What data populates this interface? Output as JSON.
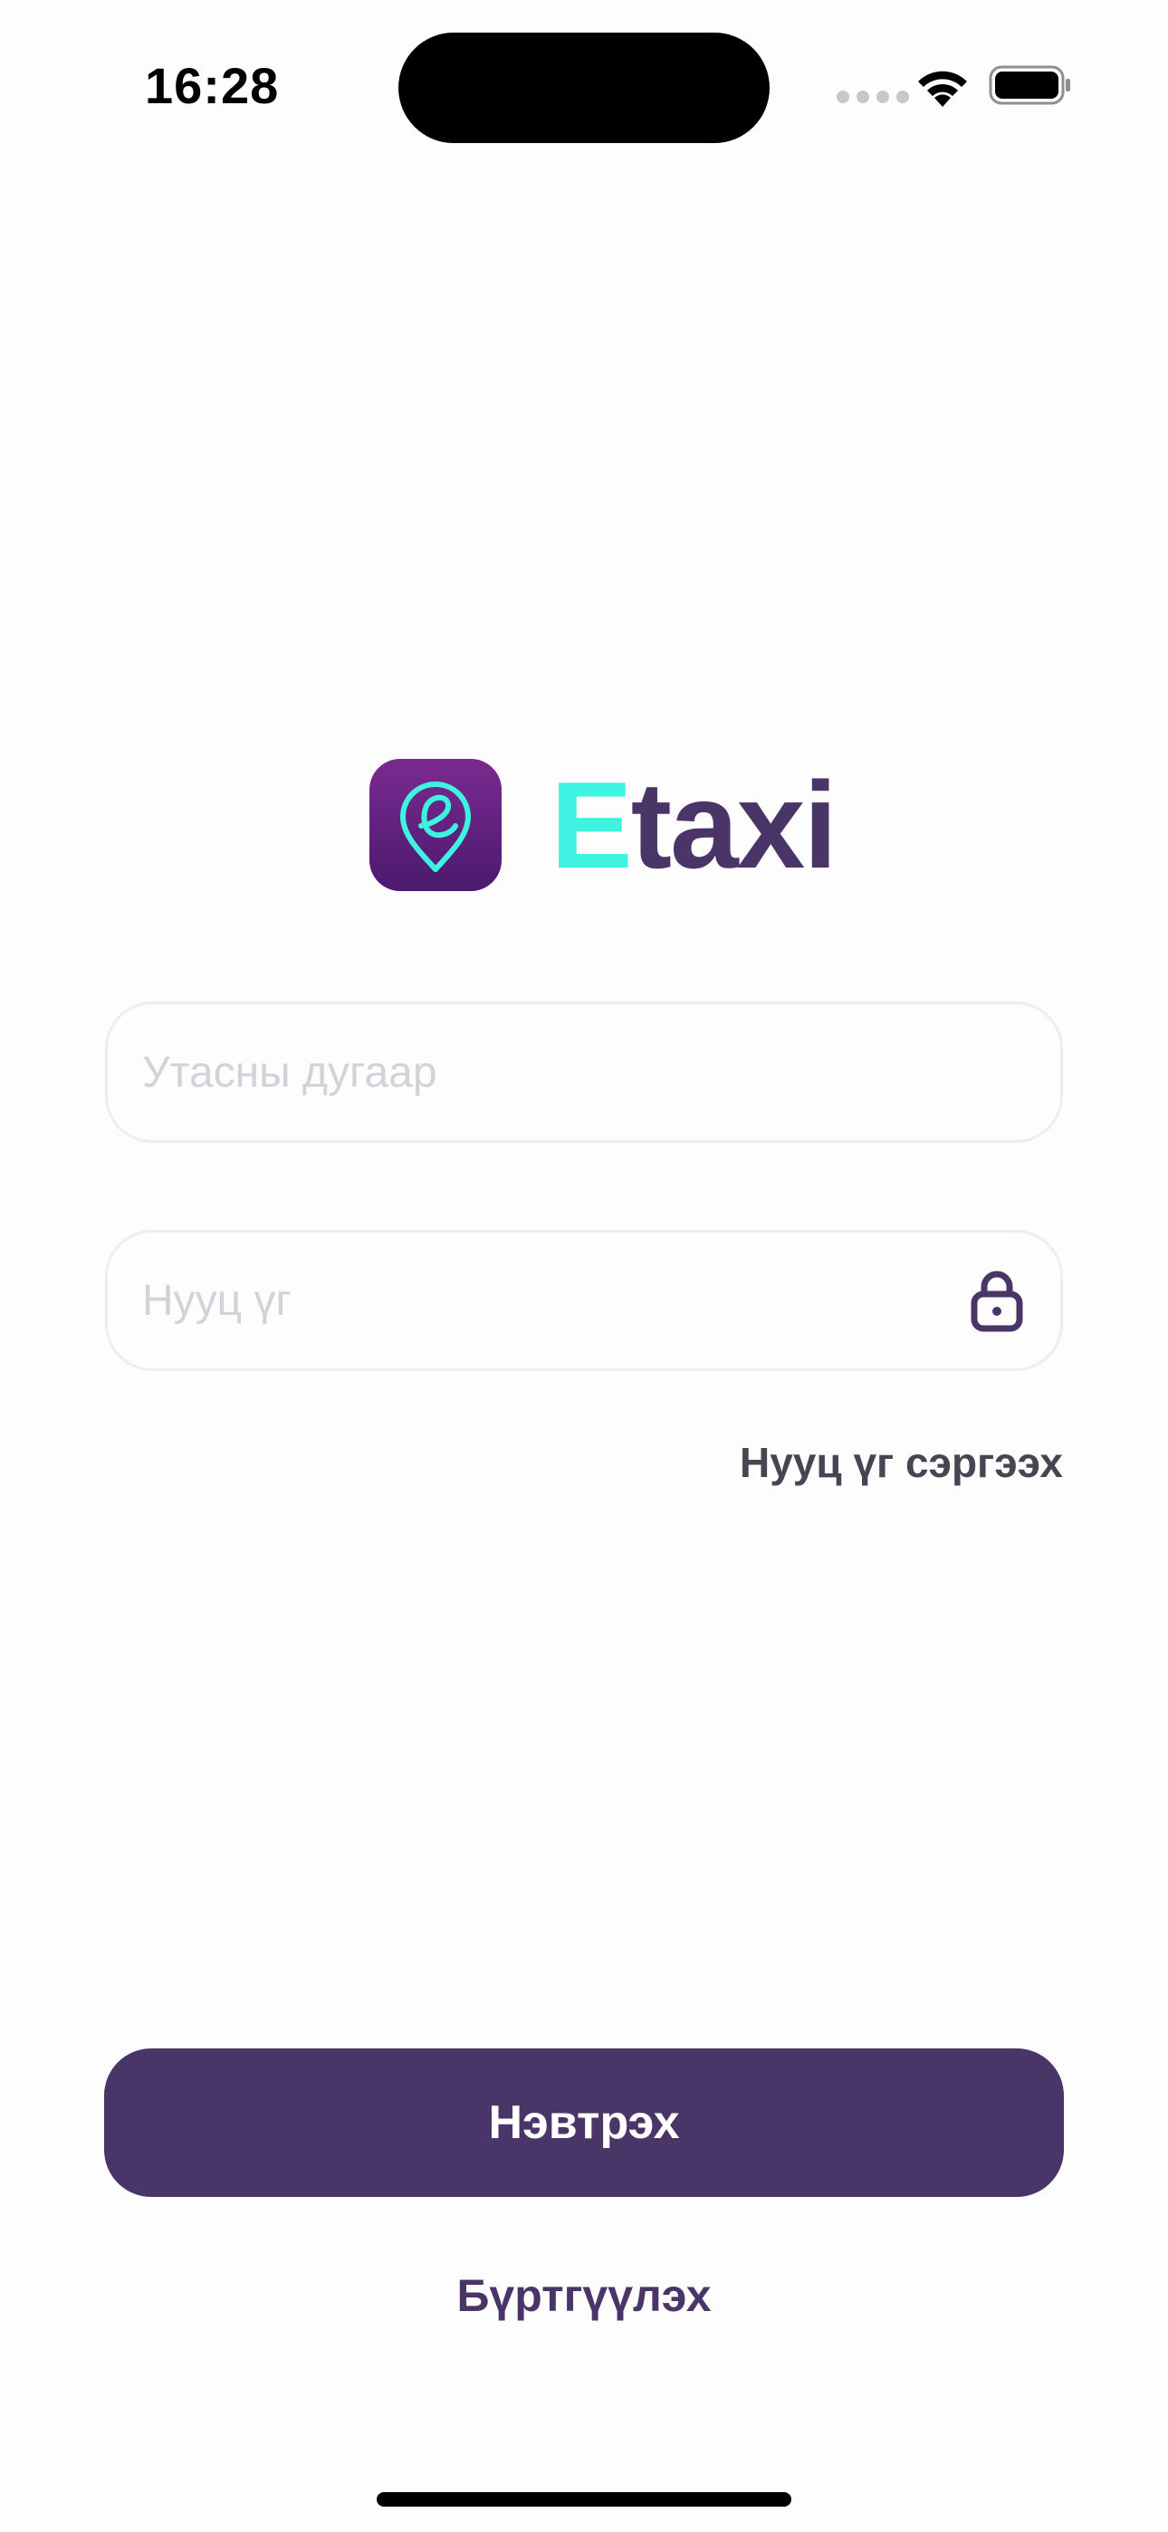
{
  "status_bar": {
    "time": "16:28",
    "icons": [
      "signal-dots-icon",
      "wifi-icon",
      "battery-icon"
    ]
  },
  "logo": {
    "icon": "location-pin-e-icon",
    "brand_first": "E",
    "brand_rest": "taxi"
  },
  "form": {
    "phone_placeholder": "Утасны дугаар",
    "phone_value": "",
    "password_placeholder": "Нууц үг",
    "password_value": "",
    "password_icon": "lock-icon",
    "forgot_label": "Нууц үг сэргээх"
  },
  "actions": {
    "login_label": "Нэвтрэх",
    "register_label": "Бүртгүүлэх"
  },
  "colors": {
    "brand_primary": "#4A3568",
    "brand_accent": "#3EF3E0",
    "icon_gradient_top": "#7B2A90",
    "icon_gradient_bottom": "#4A1A6E",
    "background": "#FEFDFE",
    "placeholder": "#D4D2D8",
    "field_border": "#EFEDF1"
  }
}
